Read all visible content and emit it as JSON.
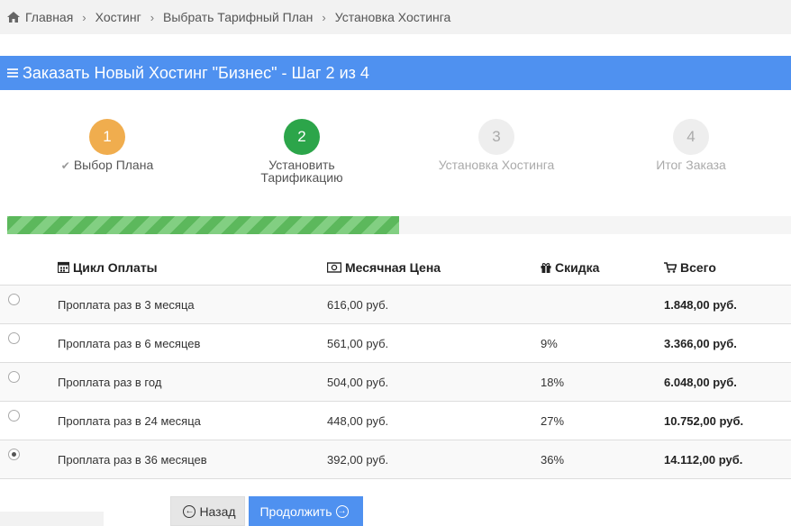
{
  "breadcrumb": {
    "items": [
      "Главная",
      "Хостинг",
      "Выбрать Тарифный План",
      "Установка Хостинга"
    ],
    "separator": "›"
  },
  "header": {
    "title": "Заказать Новый Хостинг \"Бизнес\" - Шаг 2 из 4",
    "background": "#4f91f0"
  },
  "steps": [
    {
      "number": "1",
      "label": "Выбор Плана",
      "state": "done",
      "color": "#f0ad4e"
    },
    {
      "number": "2",
      "label_line1": "Установить",
      "label_line2": "Тарификацию",
      "state": "active",
      "color": "#2ca54a"
    },
    {
      "number": "3",
      "label": "Установка Хостинга",
      "state": "pending"
    },
    {
      "number": "4",
      "label": "Итог Заказа",
      "state": "pending"
    }
  ],
  "progress": {
    "fraction": 0.5,
    "color": "#5cb85c"
  },
  "table": {
    "headers": {
      "cycle": "Цикл Оплаты",
      "monthly": "Месячная Цена",
      "discount": "Скидка",
      "total": "Всего"
    },
    "rows": [
      {
        "cycle": "Проплата раз в 3 месяца",
        "monthly": "616,00 руб.",
        "discount": "",
        "total": "1.848,00 руб.",
        "selected": false
      },
      {
        "cycle": "Проплата раз в 6 месяцев",
        "monthly": "561,00 руб.",
        "discount": "9%",
        "total": "3.366,00 руб.",
        "selected": false
      },
      {
        "cycle": "Проплата раз в год",
        "monthly": "504,00 руб.",
        "discount": "18%",
        "total": "6.048,00 руб.",
        "selected": false
      },
      {
        "cycle": "Проплата раз в 24 месяца",
        "monthly": "448,00 руб.",
        "discount": "27%",
        "total": "10.752,00 руб.",
        "selected": false
      },
      {
        "cycle": "Проплата раз в 36 месяцев",
        "monthly": "392,00 руб.",
        "discount": "36%",
        "total": "14.112,00 руб.",
        "selected": true
      }
    ]
  },
  "buttons": {
    "back": "Назад",
    "next": "Продолжить"
  }
}
